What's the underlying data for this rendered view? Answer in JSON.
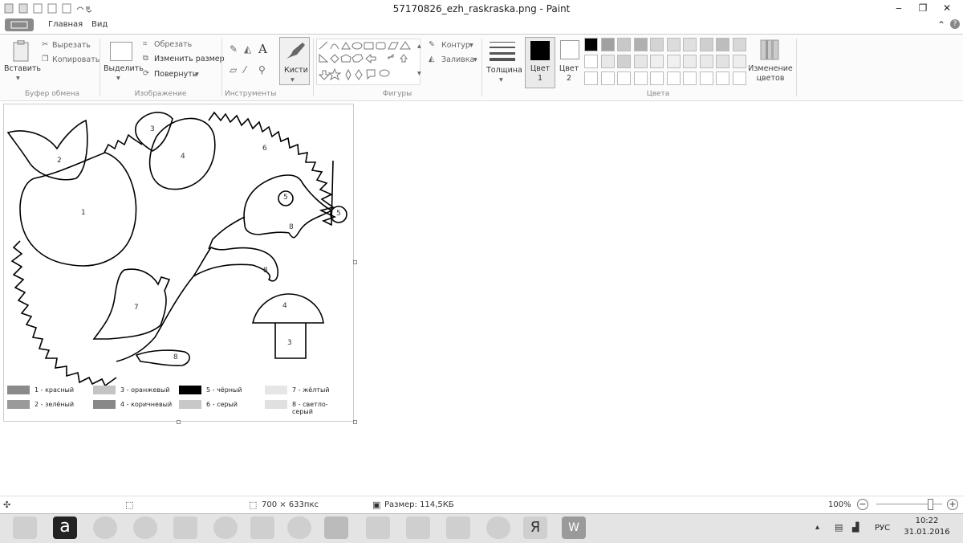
{
  "window": {
    "title": "57170826_ezh_raskraska.png - Paint",
    "controls": [
      "‒",
      "❐",
      "✕"
    ]
  },
  "tabs": {
    "file": "",
    "home": "Главная",
    "view": "Вид"
  },
  "clipboard": {
    "paste": "Вставить",
    "cut": "Вырезать",
    "copy": "Копировать",
    "group": "Буфер обмена"
  },
  "image": {
    "select": "Выделить",
    "crop": "Обрезать",
    "resize": "Изменить размер",
    "rotate": "Повернуть",
    "group": "Изображение"
  },
  "tools": {
    "group": "Инструменты",
    "text_tool": "A"
  },
  "brushes": {
    "label": "Кисти"
  },
  "shapes": {
    "outline": "Контур",
    "fill": "Заливка",
    "group": "Фигуры"
  },
  "size": {
    "label": "Толщина"
  },
  "colors": {
    "color1": "Цвет 1",
    "color2": "Цвет 2",
    "edit": "Изменение цветов",
    "group": "Цвета",
    "palette_row1": [
      "#000000",
      "#a0a0a0",
      "#c8c8c8",
      "#b0b0b0",
      "#d4d4d4",
      "#dcdcdc",
      "#e0e0e0",
      "#cfcfcf",
      "#bdbdbd",
      "#d8d8d8"
    ],
    "palette_row2": [
      "#ffffff",
      "#e8e8e8",
      "#d0d0d0",
      "#e6e6e6",
      "#efefef",
      "#f0f0f0",
      "#ececec",
      "#e9e9e9",
      "#e2e2e2",
      "#eeeeee"
    ]
  },
  "drawing": {
    "regions": [
      "1",
      "2",
      "3",
      "4",
      "6",
      "5",
      "5",
      "8",
      "8",
      "7",
      "8",
      "4",
      "3"
    ],
    "legend": [
      {
        "num": "1",
        "text": "1 - красный",
        "color": "#8a8a8a"
      },
      {
        "num": "2",
        "text": "2 - зелёный",
        "color": "#9a9a9a"
      },
      {
        "num": "3",
        "text": "3 - оранжевый",
        "color": "#c4c4c4"
      },
      {
        "num": "4",
        "text": "4 - коричневый",
        "color": "#888888"
      },
      {
        "num": "5",
        "text": "5 - чёрный",
        "color": "#000000"
      },
      {
        "num": "6",
        "text": "6 - серый",
        "color": "#c8c8c8"
      },
      {
        "num": "7",
        "text": "7 - жёлтый",
        "color": "#e6e6e6"
      },
      {
        "num": "8",
        "text": "8 - светло-серый",
        "color": "#e0e0e0"
      }
    ]
  },
  "status": {
    "dimensions": "700 × 633пкс",
    "filesize": "Размер: 114,5КБ",
    "zoom": "100%",
    "zoom_level": 1.0
  },
  "taskbar": {
    "lang": "РУС",
    "time": "10:22",
    "date": "31.01.2016"
  }
}
